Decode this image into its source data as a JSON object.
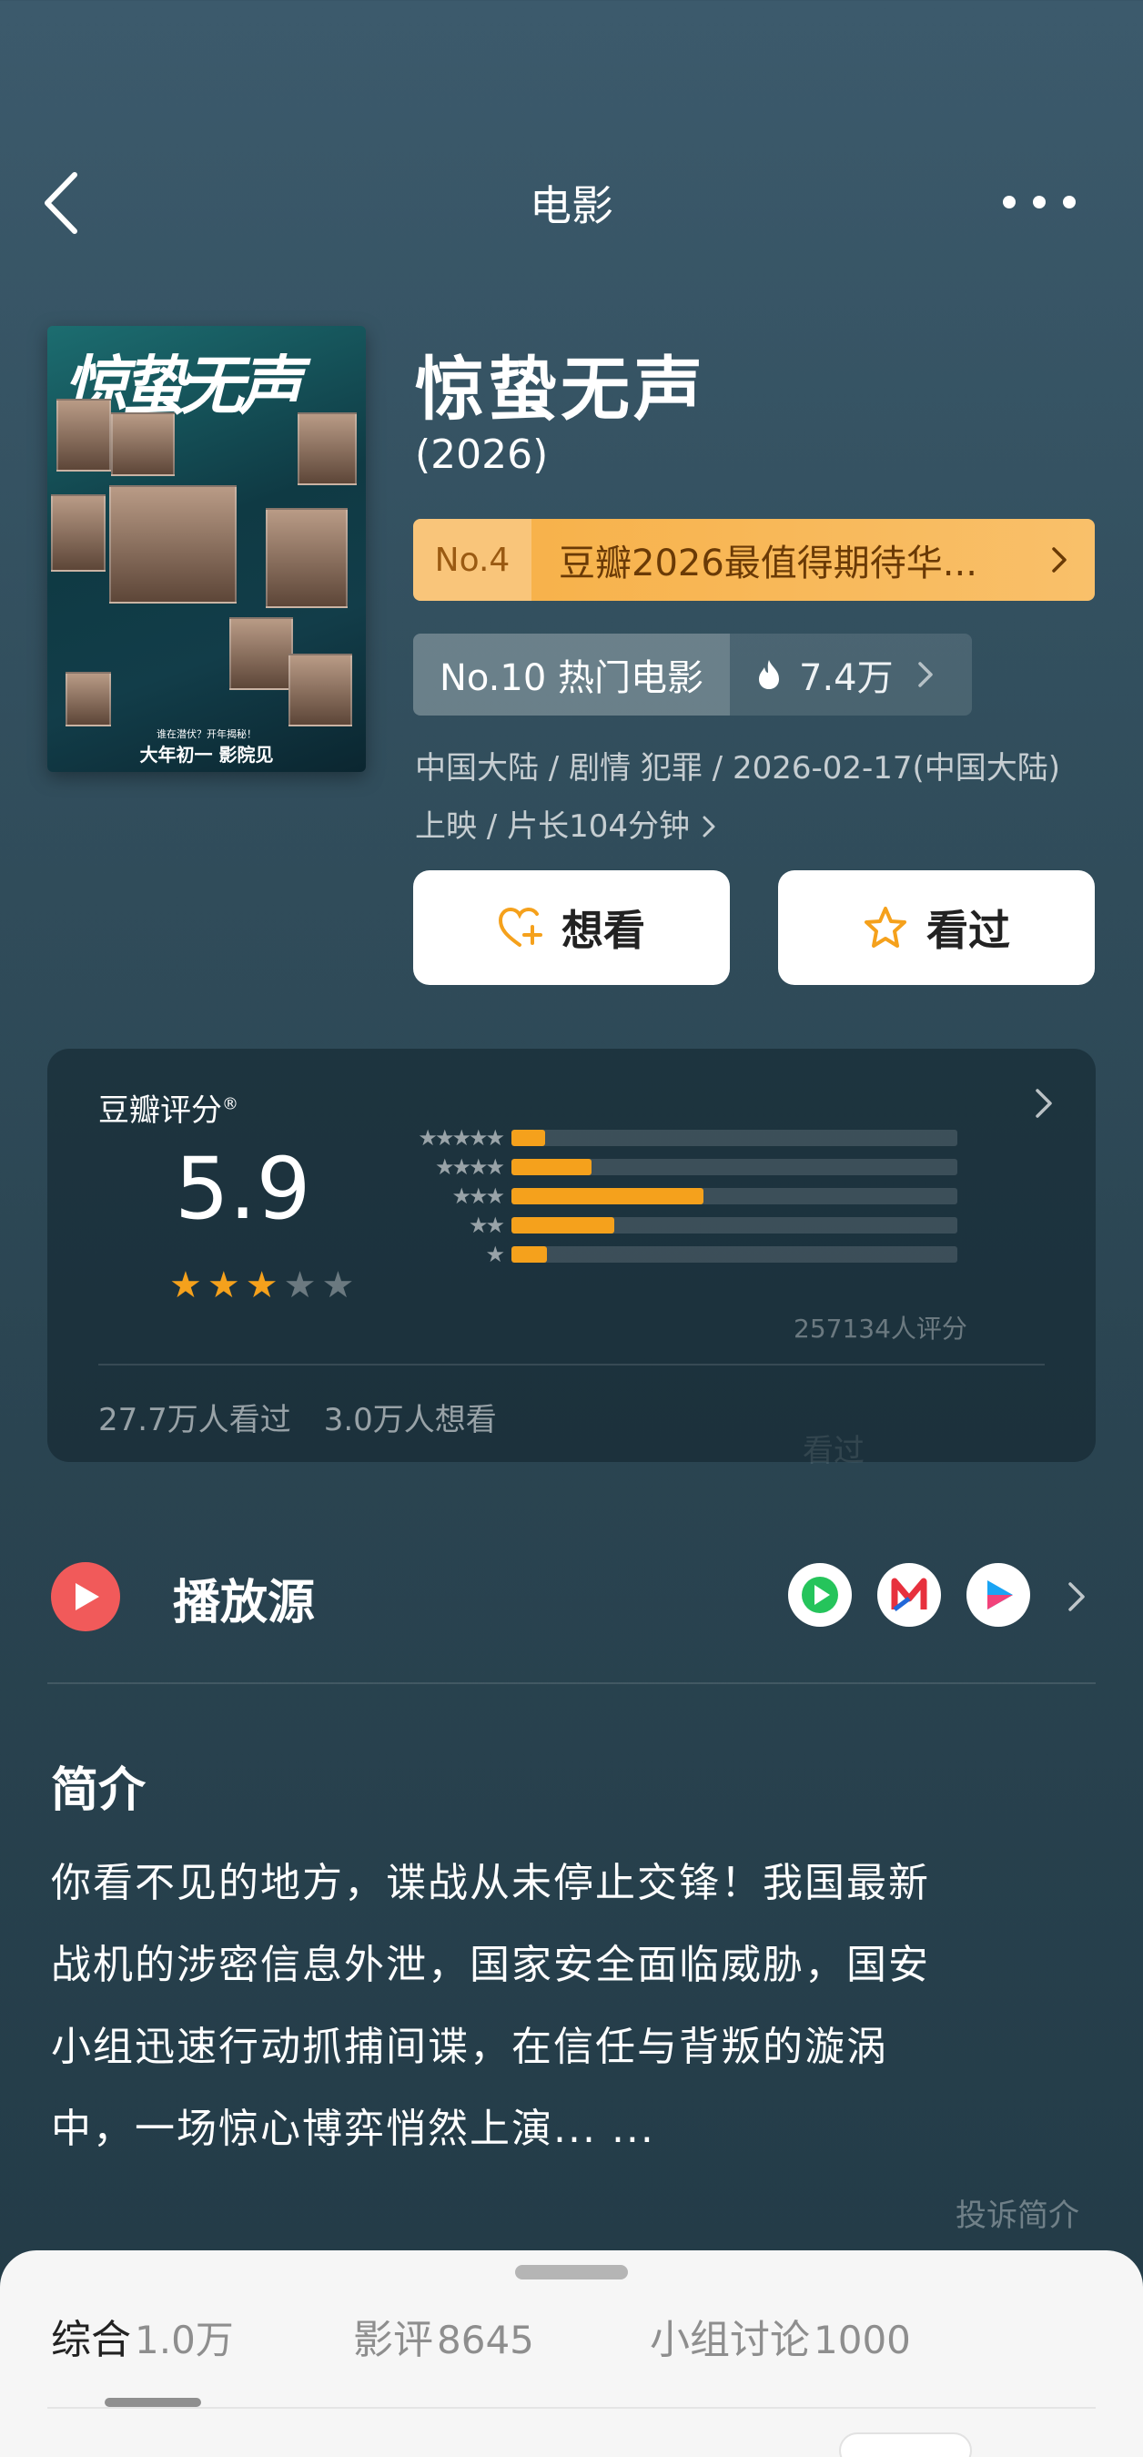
{
  "nav": {
    "title": "电影",
    "back_icon": "chevron-left-icon",
    "more_icon": "more-dots-icon"
  },
  "poster": {
    "title_art": "惊蛰无声",
    "tagline": "大年初一 影院见",
    "subline": "谁在潜伏？开年揭秘！"
  },
  "movie": {
    "title": "惊蛰无声",
    "year": "(2026)",
    "rank_primary": {
      "no": "No.4",
      "text": "豆瓣2026最值得期待华..."
    },
    "rank_secondary": {
      "no": "No.10 热门电影",
      "heat": "7.4万"
    },
    "meta_line1": "中国大陆 / 剧情 犯罪 / 2026-02-17(中国大陆)",
    "meta_line2": "上映 / 片长104分钟"
  },
  "actions": {
    "want": "想看",
    "seen": "看过"
  },
  "rating": {
    "title": "豆瓣评分",
    "score": "5.9",
    "stars_filled": 3,
    "stars_total": 5,
    "distribution_percent": [
      7.5,
      18,
      43,
      23,
      8
    ],
    "count": "257134人评分",
    "seen_stat": "27.7万人看过",
    "want_stat": "3.0万人想看",
    "faded_text": "看过"
  },
  "play_source": {
    "title": "播放源",
    "apps": [
      "iqiyi-icon",
      "mgtv-icon",
      "youku-icon"
    ]
  },
  "intro": {
    "title": "简介",
    "lines": [
      "你看不见的地方，谍战从未停止交锋！我国最新",
      "战机的涉密信息外泄，国家安全面临威胁，国安",
      "小组迅速行动抓捕间谍，在信任与背叛的漩涡",
      "中，一场惊心博弈悄然上演... ..."
    ],
    "complaint": "投诉简介"
  },
  "tabs": [
    {
      "label": "综合",
      "count": "1.0万"
    },
    {
      "label": "影评",
      "count": "8645"
    },
    {
      "label": "小组讨论",
      "count": "1000"
    }
  ],
  "colors": {
    "accent_orange": "#f5a11c",
    "play_red": "#f15a5a",
    "rank_gold": "#f7b24b"
  }
}
